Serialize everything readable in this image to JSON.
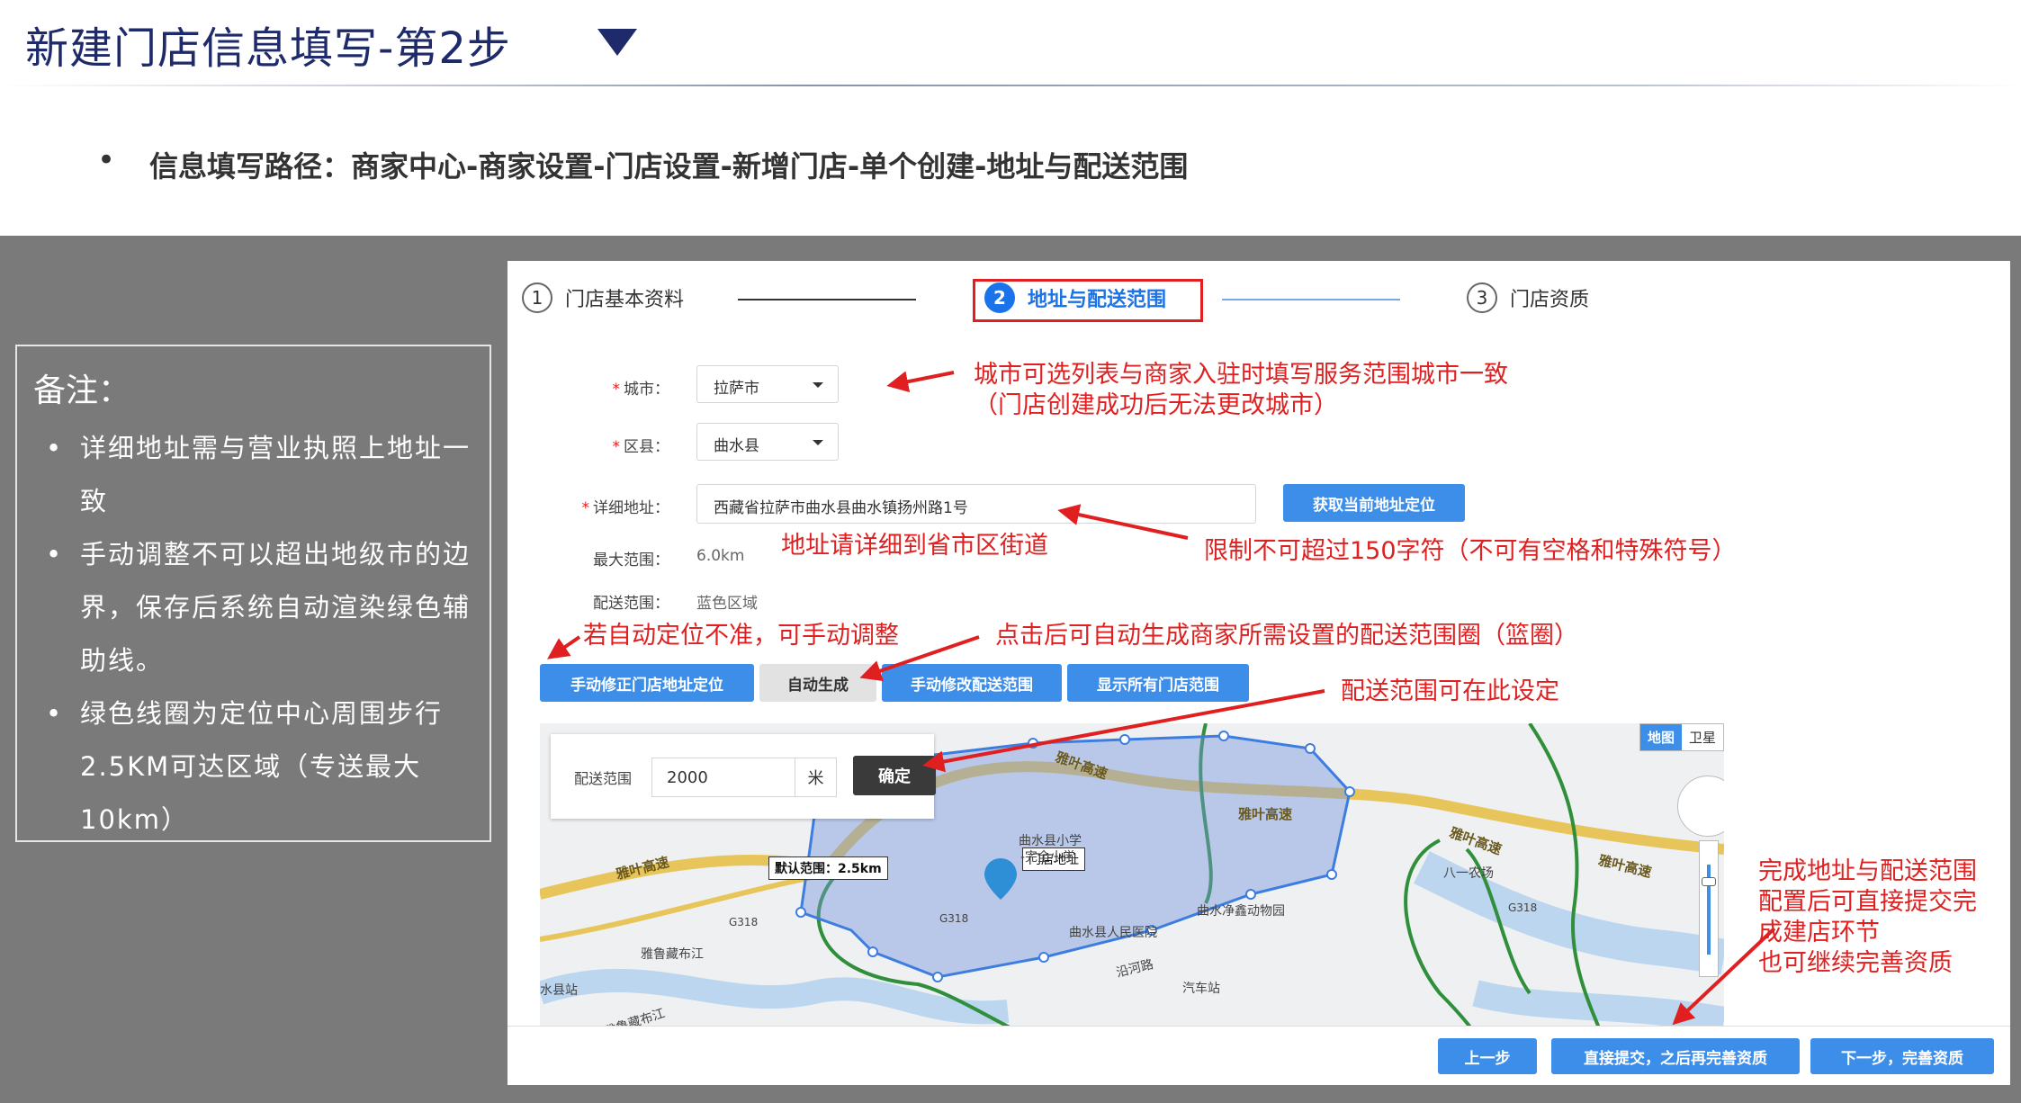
{
  "slide": {
    "title": "新建门店信息填写-第2步",
    "path_text": "信息填写路径：商家中心-商家设置-门店设置-新增门店-单个创建-地址与配送范围"
  },
  "notes": {
    "title": "备注：",
    "items": [
      "详细地址需与营业执照上地址一致",
      "手动调整不可以超出地级市的边界，保存后系统自动渲染绿色辅助线。",
      "绿色线圈为定位中心周围步行2.5KM可达区域（专送最大10km）"
    ]
  },
  "steps": [
    {
      "num": "1",
      "label": "门店基本资料"
    },
    {
      "num": "2",
      "label": "地址与配送范围"
    },
    {
      "num": "3",
      "label": "门店资质"
    }
  ],
  "form": {
    "city_label": "城市：",
    "city_value": "拉萨市",
    "district_label": "区县：",
    "district_value": "曲水县",
    "address_label": "详细地址：",
    "address_value": "西藏省拉萨市曲水县曲水镇扬州路1号",
    "locate_button": "获取当前地址定位",
    "max_range_label": "最大范围：",
    "max_range_value": "6.0km",
    "delivery_range_label": "配送范围：",
    "delivery_range_value": "蓝色区域"
  },
  "tool_buttons": [
    "手动修正门店地址定位",
    "自动生成",
    "手动修改配送范围",
    "显示所有门店范围"
  ],
  "annotations": {
    "city_note_1": "城市可选列表与商家入驻时填写服务范围城市一致",
    "city_note_2": "（门店创建成功后无法更改城市）",
    "address_detail": "地址请详细到省市区街道",
    "address_limit": "限制不可超过150字符（不可有空格和特殊符号）",
    "manual_adjust": "若自动定位不准，可手动调整",
    "auto_generate": "点击后可自动生成商家所需设置的配送范围圈（篮圈）",
    "range_set": "配送范围可在此设定",
    "submit_note_1": "完成地址与配送范围",
    "submit_note_2": "配置后可直接提交完",
    "submit_note_3": "成建店环节",
    "submit_note_4": "也可继续完善资质"
  },
  "map": {
    "range_label": "配送范围",
    "range_value": "2000",
    "range_unit": "米",
    "confirm_button": "确定",
    "type_map": "地图",
    "type_satellite": "卫星",
    "default_range": "默认范围：2.5km",
    "store_address": "门店地址",
    "labels": {
      "road1": "雅叶高速",
      "road2": "雅叶高速",
      "road3": "雅叶高速",
      "road4": "雅叶高速",
      "road5": "雅叶高速",
      "school1": "曲水县小学",
      "school2": "-完全小学",
      "zoo": "曲水净鑫动物园",
      "hospital": "曲水县人民医院",
      "river1": "雅鲁藏布江",
      "river2": "雅鲁藏布江",
      "station1": "水县站",
      "station2": "汽车站",
      "farm": "八一农场",
      "hwy1": "G318",
      "hwy2": "G318",
      "hwy3": "G318",
      "street": "沿河路"
    }
  },
  "footer": {
    "prev": "上一步",
    "submit": "直接提交，之后再完善资质",
    "next": "下一步，完善资质"
  }
}
